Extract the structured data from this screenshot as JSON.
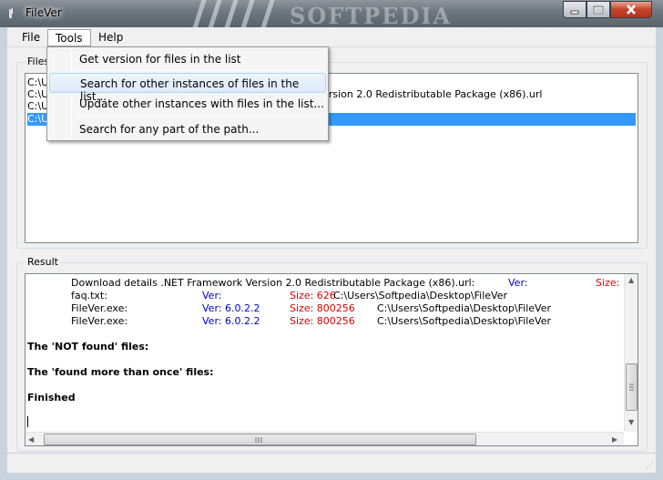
{
  "window": {
    "title": "FileVer",
    "watermark": "SOFTPEDIA"
  },
  "menubar": {
    "file": "File",
    "tools": "Tools",
    "help": "Help"
  },
  "tools_menu": {
    "items": [
      "Get version for files in the list",
      "Search for other instances of files in the list...",
      "Update other instances with files in the list...",
      "Search for any part of the path..."
    ],
    "highlighted_index": 1
  },
  "files_group": {
    "label": "Files",
    "items": [
      {
        "text": "C:\\U",
        "selected": false
      },
      {
        "text": "C:\\U",
        "selected": false,
        "tail": "rk Version 2.0 Redistributable Package (x86).url"
      },
      {
        "text": "C:\\U",
        "selected": false
      },
      {
        "text": "C:\\U",
        "selected": true
      }
    ]
  },
  "result_group": {
    "label": "Result",
    "rows": [
      {
        "name": "Download details .NET Framework Version 2.0 Redistributable Package (x86).url:",
        "ver": "Ver:",
        "size": "Size: :"
      },
      {
        "name": "faq.txt:",
        "ver": "Ver:",
        "size": "Size: 626",
        "path": "C:\\Users\\Softpedia\\Desktop\\FileVer"
      },
      {
        "name": "FileVer.exe:",
        "ver": "Ver: 6.0.2.2",
        "size": "Size: 800256",
        "path": "C:\\Users\\Softpedia\\Desktop\\FileVer"
      },
      {
        "name": "FileVer.exe:",
        "ver": "Ver: 6.0.2.2",
        "size": "Size: 800256",
        "path": "C:\\Users\\Softpedia\\Desktop\\FileVer"
      }
    ],
    "not_found": "The 'NOT found' files:",
    "found_more": "The 'found more than once' files:",
    "finished": "Finished"
  },
  "colors": {
    "selection": "#3399ff",
    "version": "#0000cc",
    "size": "#dd0000",
    "menu_highlight": "#dceafb"
  },
  "icons": [
    "app-icon",
    "minimize-icon",
    "maximize-icon",
    "close-icon",
    "scroll-up-icon",
    "scroll-down-icon",
    "scroll-left-icon",
    "scroll-right-icon",
    "size-grip-icon"
  ]
}
